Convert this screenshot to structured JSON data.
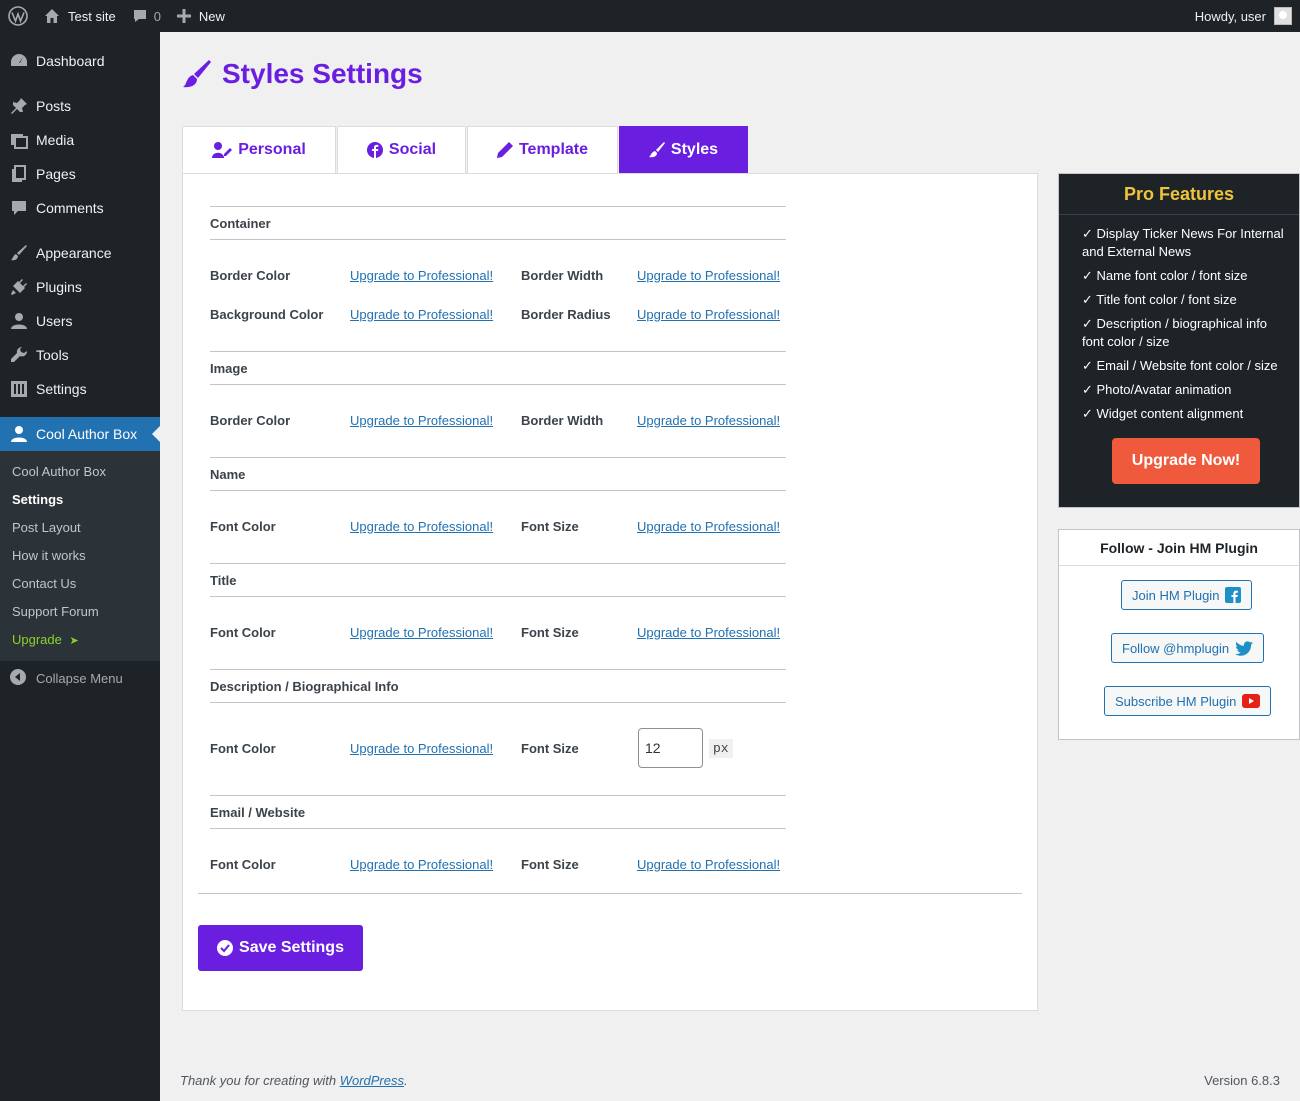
{
  "admin_bar": {
    "site_name": "Test site",
    "comments_count": "0",
    "new_label": "New",
    "howdy": "Howdy, user"
  },
  "sidebar": {
    "items": [
      {
        "label": "Dashboard",
        "icon": "dashboard-icon"
      },
      {
        "label": "Posts",
        "icon": "pin-icon"
      },
      {
        "label": "Media",
        "icon": "media-icon"
      },
      {
        "label": "Pages",
        "icon": "pages-icon"
      },
      {
        "label": "Comments",
        "icon": "comment-icon"
      },
      {
        "label": "Appearance",
        "icon": "brush-icon"
      },
      {
        "label": "Plugins",
        "icon": "plug-icon"
      },
      {
        "label": "Users",
        "icon": "user-icon"
      },
      {
        "label": "Tools",
        "icon": "wrench-icon"
      },
      {
        "label": "Settings",
        "icon": "settings-icon"
      },
      {
        "label": "Cool Author Box",
        "icon": "author-icon"
      }
    ],
    "submenu": [
      "Cool Author Box",
      "Settings",
      "Post Layout",
      "How it works",
      "Contact Us",
      "Support Forum",
      "Upgrade"
    ],
    "upgrade_arrow": "➤",
    "collapse_label": "Collapse Menu"
  },
  "page": {
    "title": "Styles Settings",
    "tabs": [
      "Personal",
      "Social",
      "Template",
      "Styles"
    ],
    "upgrade_link": "Upgrade to Professional!",
    "sections": {
      "container": "Container",
      "image": "Image",
      "name": "Name",
      "title": "Title",
      "description": "Description / Biographical Info",
      "email": "Email / Website"
    },
    "labels": {
      "border_color": "Border Color",
      "border_width": "Border Width",
      "background_color": "Background Color",
      "border_radius": "Border Radius",
      "font_color": "Font Color",
      "font_size": "Font Size"
    },
    "desc_font_size_value": "12",
    "px_unit": "px",
    "save_label": "Save Settings"
  },
  "pro": {
    "title": "Pro Features",
    "features": [
      "✓ Display Ticker News For Internal and External News",
      "✓ Name font color / font size",
      "✓ Title font color / font size",
      "✓ Description / biographical info font color / size",
      "✓ Email / Website font color / size",
      "✓ Photo/Avatar animation",
      "✓ Widget content alignment"
    ],
    "upgrade_label": "Upgrade Now!"
  },
  "follow": {
    "title": "Follow - Join HM Plugin",
    "join": "Join HM Plugin",
    "twitter": "Follow @hmplugin",
    "subscribe": "Subscribe HM Plugin"
  },
  "footer": {
    "thanks_prefix": "Thank you for creating with",
    "wordpress_link": "WordPress",
    "thanks_suffix": ".",
    "version": "Version 6.8.3"
  },
  "colors": {
    "accent": "#6a1ee0",
    "admin_dark": "#1d2327",
    "wp_blue": "#2271b1",
    "pro_gold": "#f0c33c",
    "upgrade_orange": "#f05a3c"
  }
}
